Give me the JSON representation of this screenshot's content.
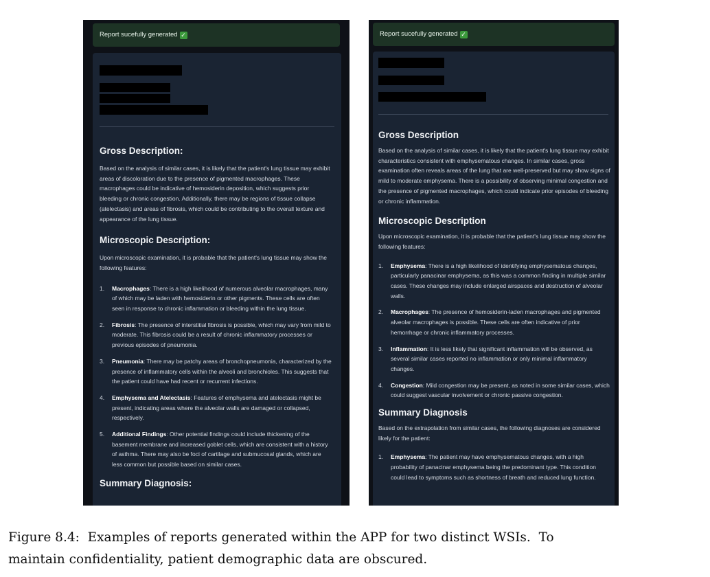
{
  "panels": {
    "left": {
      "success_message": "Report sucefully generated",
      "gross": {
        "heading": "Gross Description:",
        "text": "Based on the analysis of similar cases, it is likely that the patient's lung tissue may exhibit areas of discoloration due to the presence of pigmented macrophages. These macrophages could be indicative of hemosiderin deposition, which suggests prior bleeding or chronic congestion. Additionally, there may be regions of tissue collapse (atelectasis) and areas of fibrosis, which could be contributing to the overall texture and appearance of the lung tissue."
      },
      "micro": {
        "heading": "Microscopic Description:",
        "intro": "Upon microscopic examination, it is probable that the patient's lung tissue may show the following features:",
        "items": [
          {
            "num": "1.",
            "term": "Macrophages",
            "text": ": There is a high likelihood of numerous alveolar macrophages, many of which may be laden with hemosiderin or other pigments. These cells are often seen in response to chronic inflammation or bleeding within the lung tissue."
          },
          {
            "num": "2.",
            "term": "Fibrosis",
            "text": ": The presence of interstitial fibrosis is possible, which may vary from mild to moderate. This fibrosis could be a result of chronic inflammatory processes or previous episodes of pneumonia."
          },
          {
            "num": "3.",
            "term": "Pneumonia",
            "text": ": There may be patchy areas of bronchopneumonia, characterized by the presence of inflammatory cells within the alveoli and bronchioles. This suggests that the patient could have had recent or recurrent infections."
          },
          {
            "num": "4.",
            "term": "Emphysema and Atelectasis",
            "text": ": Features of emphysema and atelectasis might be present, indicating areas where the alveolar walls are damaged or collapsed, respectively."
          },
          {
            "num": "5.",
            "term": "Additional Findings",
            "text": ": Other potential findings could include thickening of the basement membrane and increased goblet cells, which are consistent with a history of asthma. There may also be foci of cartilage and submucosal glands, which are less common but possible based on similar cases."
          }
        ]
      },
      "summary": {
        "heading": "Summary Diagnosis:"
      }
    },
    "right": {
      "success_message": "Report sucefully generated",
      "gross": {
        "heading": "Gross Description",
        "text": "Based on the analysis of similar cases, it is likely that the patient's lung tissue may exhibit characteristics consistent with emphysematous changes. In similar cases, gross examination often reveals areas of the lung that are well-preserved but may show signs of mild to moderate emphysema. There is a possibility of observing minimal congestion and the presence of pigmented macrophages, which could indicate prior episodes of bleeding or chronic inflammation."
      },
      "micro": {
        "heading": "Microscopic Description",
        "intro": "Upon microscopic examination, it is probable that the patient's lung tissue may show the following features:",
        "items": [
          {
            "num": "1.",
            "term": "Emphysema",
            "text": ": There is a high likelihood of identifying emphysematous changes, particularly panacinar emphysema, as this was a common finding in multiple similar cases. These changes may include enlarged airspaces and destruction of alveolar walls."
          },
          {
            "num": "2.",
            "term": "Macrophages",
            "text": ": The presence of hemosiderin-laden macrophages and pigmented alveolar macrophages is possible. These cells are often indicative of prior hemorrhage or chronic inflammatory processes."
          },
          {
            "num": "3.",
            "term": "Inflammation",
            "text": ": It is less likely that significant inflammation will be observed, as several similar cases reported no inflammation or only minimal inflammatory changes."
          },
          {
            "num": "4.",
            "term": "Congestion",
            "text": ": Mild congestion may be present, as noted in some similar cases, which could suggest vascular involvement or chronic passive congestion."
          }
        ]
      },
      "summary": {
        "heading": "Summary Diagnosis",
        "intro": "Based on the extrapolation from similar cases, the following diagnoses are considered likely for the patient:",
        "items": [
          {
            "num": "1.",
            "term": "Emphysema",
            "text": ": The patient may have emphysematous changes, with a high probability of panacinar emphysema being the predominant type. This condition could lead to symptoms such as shortness of breath and reduced lung function."
          }
        ]
      }
    }
  },
  "caption": {
    "line1": "Figure 8.4:  Examples of reports generated within the APP for two distinct WSIs.  To",
    "line2": "maintain confidentiality, patient demographic data are obscured."
  }
}
